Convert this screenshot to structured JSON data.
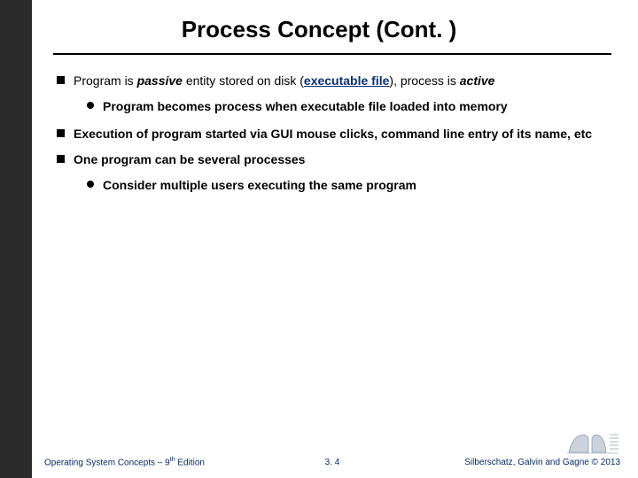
{
  "title": "Process Concept (Cont. )",
  "bullets": {
    "b1_1a": "Program is ",
    "b1_1b": "passive",
    "b1_1c": " entity stored on disk (",
    "b1_1d": "executable file",
    "b1_1e": "), process is ",
    "b1_1f": "active",
    "b2_1": "Program becomes process when executable file loaded into memory",
    "b1_2": "Execution of program started via GUI mouse clicks, command line entry of its name, etc",
    "b1_3": "One program can be several processes",
    "b2_2": "Consider multiple users executing the same program"
  },
  "footer": {
    "left_a": "Operating System Concepts – 9",
    "left_sup": "th",
    "left_b": " Edition",
    "center": "3. 4",
    "right": "Silberschatz, Galvin and Gagne © 2013"
  }
}
